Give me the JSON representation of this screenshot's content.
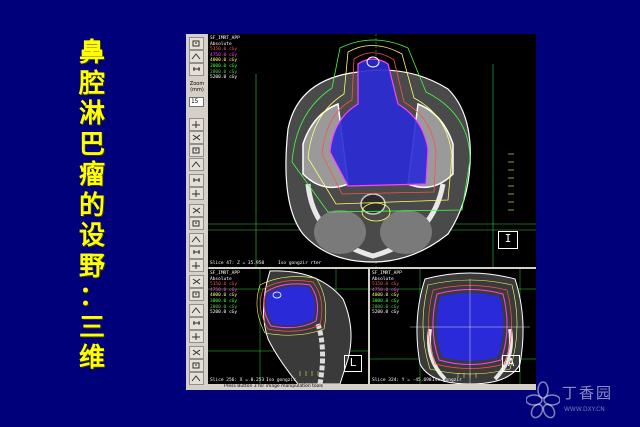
{
  "slide": {
    "title_chars": [
      "鼻",
      "腔",
      "淋",
      "巴",
      "瘤",
      "的",
      "设",
      "野",
      "：",
      "三",
      "维"
    ],
    "background": "#00007a",
    "title_color": "#ffff00"
  },
  "toolbar": {
    "zoom_label": "Zoom\n(mm)",
    "zoom_value": "15",
    "icons": [
      "zoom-in-icon",
      "zoom-out-icon",
      "ruler-icon",
      "profile-icon",
      "scroll-icon",
      "pan-icon",
      "window-level-icon",
      "point-icon",
      "slice-up-icon",
      "slice-down-icon",
      "select-icon",
      "contour-icon",
      "beam-icon",
      "grid-icon",
      "search-icon",
      "dose-icon",
      "hand-icon",
      "measure-icon",
      "isodose-icon",
      "reset-icon",
      "rotate-icon",
      "text-icon",
      "undo-icon"
    ]
  },
  "views": {
    "axial": {
      "plan_name": "SF_IMRT_APP",
      "mode": "Absolute",
      "slice_text": "Slice 47: Z = 35.950",
      "iso_text": "Iso  gongzir rter",
      "orientation": "I",
      "isodose": [
        {
          "label": "5150.0 cGy",
          "color": "#ff5050"
        },
        {
          "label": "4750.0 cGy",
          "color": "#ff40ff"
        },
        {
          "label": "4000.0 cGy",
          "color": "#ffff66"
        },
        {
          "label": "3000.0 cGy",
          "color": "#40ff40"
        },
        {
          "label": "2000.0 cGy",
          "color": "#50c850"
        },
        {
          "label": "5200.0 cGy",
          "color": "#ffffff"
        }
      ]
    },
    "sagittal": {
      "plan_name": "SF_IMRT_APP",
      "mode": "Absolute",
      "slice_text": "Slice 256: X = 0.253",
      "iso_text": "Iso  gongzir",
      "orientation": "L",
      "isodose": [
        {
          "label": "5150.0 cGy",
          "color": "#ff5050"
        },
        {
          "label": "4750.0 cGy",
          "color": "#ff40ff"
        },
        {
          "label": "4000.0 cGy",
          "color": "#ffff66"
        },
        {
          "label": "3000.0 cGy",
          "color": "#40ff40"
        },
        {
          "label": "2000.0 cGy",
          "color": "#50c850"
        },
        {
          "label": "5200.0 cGy",
          "color": "#ffffff"
        }
      ]
    },
    "coronal": {
      "plan_name": "SF_IMRT_APP",
      "mode": "Absolute",
      "slice_text": "Slice 324: Y = -45.698",
      "iso_text": "Iso  gongzir",
      "orientation": "A",
      "isodose": [
        {
          "label": "5150.0 cGy",
          "color": "#ff5050"
        },
        {
          "label": "4750.0 cGy",
          "color": "#ff40ff"
        },
        {
          "label": "4000.0 cGy",
          "color": "#ffff66"
        },
        {
          "label": "3000.0 cGy",
          "color": "#40ff40"
        },
        {
          "label": "2000.0 cGy",
          "color": "#50c850"
        },
        {
          "label": "5200.0 cGy",
          "color": "#ffffff"
        }
      ]
    }
  },
  "status_bar": "Press Button 3 for image manipulation tools",
  "watermark": {
    "name": "丁香园",
    "url": "WWW.DXY.CN"
  }
}
